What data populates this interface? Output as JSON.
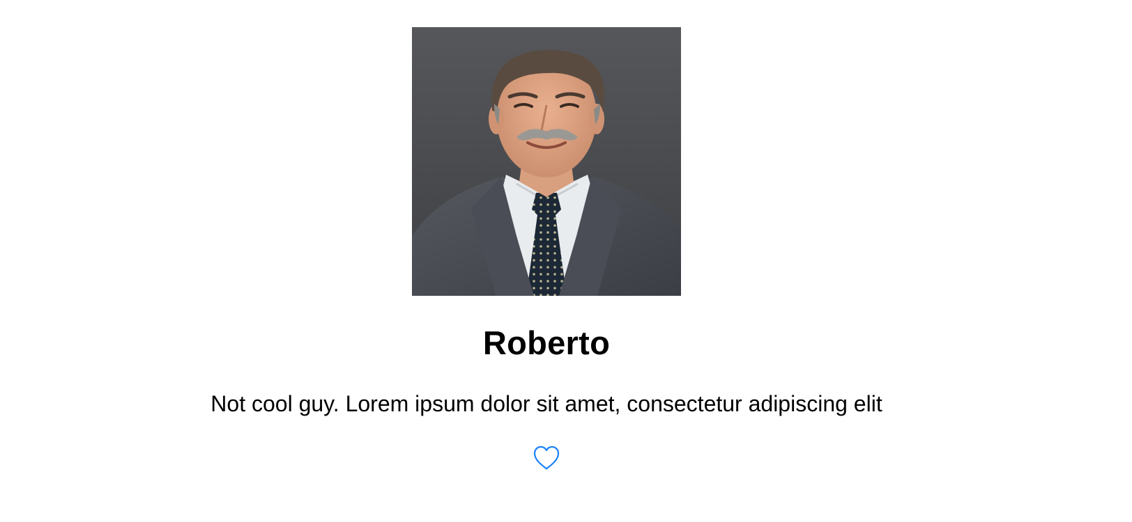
{
  "profile": {
    "name": "Roberto",
    "bio": "Not cool guy. Lorem ipsum dolor sit amet, consectetur adipiscing elit",
    "photo_alt": "Portrait photo"
  },
  "icons": {
    "like": "heart-outline-icon"
  },
  "colors": {
    "accent": "#1a82fb",
    "text": "#000000",
    "background": "#ffffff"
  }
}
